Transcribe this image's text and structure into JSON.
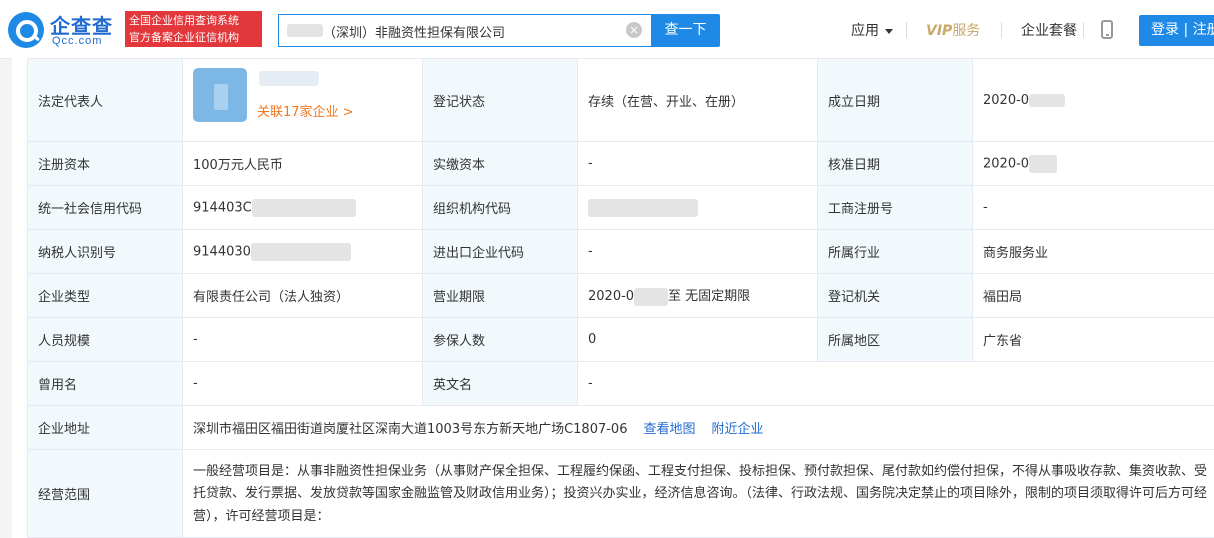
{
  "header": {
    "logo_cn": "企查查",
    "logo_en": "Qcc.com",
    "badge_line1": "全国企业信用查询系统",
    "badge_line2": "官方备案企业征信机构",
    "search_value": "（深圳）非融资性担保有限公司",
    "search_button": "查一下",
    "nav_app": "应用",
    "nav_vip_prefix": "VIP",
    "nav_vip_suffix": "服务",
    "nav_package": "企业套餐",
    "login": "登录 | 注册"
  },
  "info": {
    "legal_rep_label": "法定代表人",
    "legal_rep_related": "关联17家企业 >",
    "reg_status_label": "登记状态",
    "reg_status_value": "存续（在营、开业、在册）",
    "established_label": "成立日期",
    "established_value": "2020-0",
    "reg_capital_label": "注册资本",
    "reg_capital_value": "100万元人民币",
    "paid_capital_label": "实缴资本",
    "paid_capital_value": "-",
    "approval_date_label": "核准日期",
    "approval_date_value": "2020-0",
    "credit_code_label": "统一社会信用代码",
    "credit_code_value": "914403C",
    "org_code_label": "组织机构代码",
    "biz_reg_no_label": "工商注册号",
    "biz_reg_no_value": "-",
    "taxpayer_label": "纳税人识别号",
    "taxpayer_value": "9144030",
    "import_export_label": "进出口企业代码",
    "import_export_value": "-",
    "industry_label": "所属行业",
    "industry_value": "商务服务业",
    "company_type_label": "企业类型",
    "company_type_value": "有限责任公司（法人独资）",
    "biz_term_label": "营业期限",
    "biz_term_start": "2020-0",
    "biz_term_end": "至 无固定期限",
    "reg_authority_label": "登记机关",
    "reg_authority_value": "福田局",
    "staff_size_label": "人员规模",
    "staff_size_value": "-",
    "insured_label": "参保人数",
    "insured_value": "0",
    "region_label": "所属地区",
    "region_value": "广东省",
    "former_name_label": "曾用名",
    "former_name_value": "-",
    "english_name_label": "英文名",
    "english_name_value": "-",
    "address_label": "企业地址",
    "address_value": "深圳市福田区福田街道岗厦社区深南大道1003号东方新天地广场C1807-06",
    "view_map": "查看地图",
    "nearby": "附近企业",
    "scope_label": "经营范围",
    "scope_value": "一般经营项目是：从事非融资性担保业务（从事财产保全担保、工程履约保函、工程支付担保、投标担保、预付款担保、尾付款如约偿付担保，不得从事吸收存款、集资收款、受托贷款、发行票据、发放贷款等国家金融监管及财政信用业务）；投资兴办实业，经济信息咨询。（法律、行政法规、国务院决定禁止的项目除外，限制的项目须取得许可后方可经营），许可经营项目是："
  },
  "colors": {
    "accent": "#1f8ae6",
    "badge_red": "#e2373b",
    "vip_gold": "#c9a86a",
    "link_orange": "#f07820",
    "key_bg": "#f2f9fc"
  }
}
